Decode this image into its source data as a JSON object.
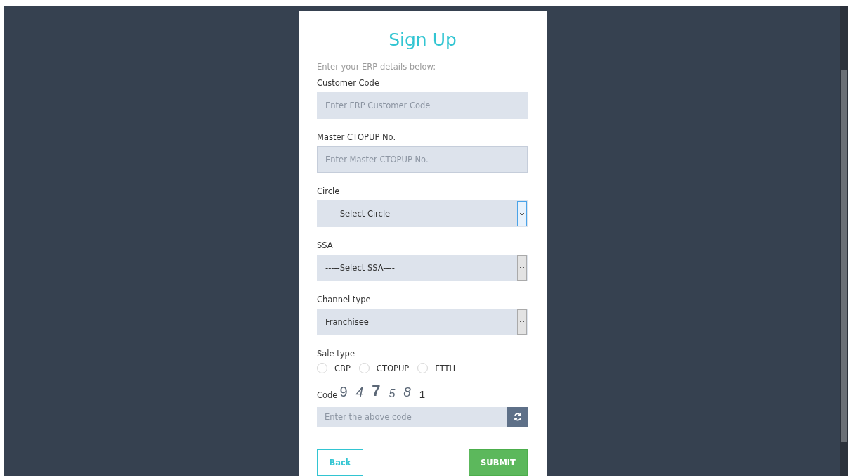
{
  "title": "Sign Up",
  "subtitle": "Enter your ERP details below:",
  "fields": [
    {
      "kind": "input",
      "label": "Customer Code",
      "placeholder": "Enter ERP Customer Code",
      "focused": false
    },
    {
      "kind": "input",
      "label": "Master CTOPUP No.",
      "placeholder": "Enter Master CTOPUP No.",
      "focused": true
    },
    {
      "kind": "select",
      "label": "Circle",
      "value": "-----Select Circle----",
      "focused": true
    },
    {
      "kind": "select",
      "label": "SSA",
      "value": "-----Select SSA----",
      "focused": false
    },
    {
      "kind": "select",
      "label": "Channel type",
      "value": "Franchisee",
      "focused": false
    }
  ],
  "sale_type": {
    "label": "Sale type",
    "options": [
      {
        "label": "CBP",
        "selected": false
      },
      {
        "label": "CTOPUP",
        "selected": false
      },
      {
        "label": "FTTH",
        "selected": false
      }
    ]
  },
  "captcha": {
    "label": "Code",
    "digits": [
      "9",
      "4",
      "7",
      "5",
      "8",
      "1"
    ],
    "placeholder": "Enter the above code"
  },
  "buttons": {
    "back": "Back",
    "submit": "SUBMIT"
  }
}
